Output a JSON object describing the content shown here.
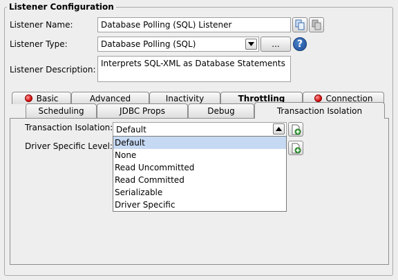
{
  "group": {
    "title": "Listener Configuration"
  },
  "form": {
    "name_label": "Listener Name:",
    "name_value": "Database Polling (SQL) Listener",
    "type_label": "Listener Type:",
    "type_value": "Database Polling (SQL)",
    "browse_label": "...",
    "help_label": "?",
    "description_label": "Listener Description:",
    "description_value": "Interprets SQL-XML as Database Statements"
  },
  "tabs_row1": [
    {
      "label": "Basic",
      "icon": "red-dot-icon"
    },
    {
      "label": "Advanced"
    },
    {
      "label": "Inactivity"
    },
    {
      "label": "Throttling",
      "bold": true
    },
    {
      "label": "Connection",
      "icon": "red-dot-icon"
    }
  ],
  "tabs_row2": [
    {
      "label": "Scheduling"
    },
    {
      "label": "JDBC Props"
    },
    {
      "label": "Debug"
    },
    {
      "label": "Transaction Isolation",
      "active": true
    }
  ],
  "panel": {
    "isolation_label": "Transaction Isolation:",
    "isolation_value": "Default",
    "driver_label": "Driver Specific Level:",
    "options": [
      "Default",
      "None",
      "Read Uncommitted",
      "Read Committed",
      "Serializable",
      "Driver Specific"
    ],
    "selected_option": "Default"
  },
  "colors": {
    "background": "#eeeeee",
    "selection": "#c6d9f2",
    "status_red": "#d00000",
    "help_blue": "#1c4d97"
  }
}
